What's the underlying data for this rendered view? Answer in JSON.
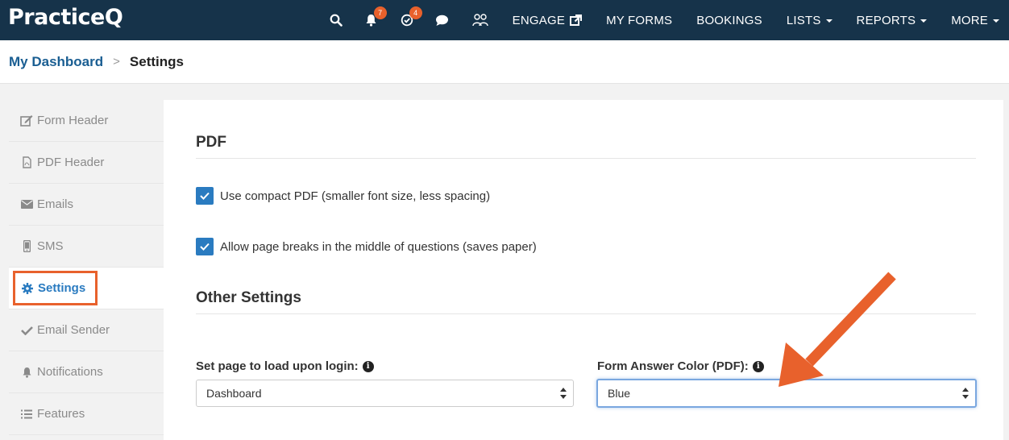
{
  "app": {
    "logo_text": "Practice",
    "logo_q": "Q"
  },
  "nav": {
    "notifications_count": "7",
    "tasks_count": "4",
    "links": [
      {
        "label": "ENGAGE",
        "icon": "external-link-icon"
      },
      {
        "label": "MY FORMS"
      },
      {
        "label": "BOOKINGS"
      },
      {
        "label": "LISTS",
        "dropdown": true
      },
      {
        "label": "REPORTS",
        "dropdown": true
      },
      {
        "label": "MORE",
        "dropdown": true
      }
    ]
  },
  "breadcrumb": {
    "parent": "My Dashboard",
    "separator": ">",
    "current": "Settings"
  },
  "sidebar": {
    "items": [
      {
        "label": "Form Header",
        "icon": "edit-icon"
      },
      {
        "label": "PDF Header",
        "icon": "pdf-file-icon"
      },
      {
        "label": "Emails",
        "icon": "envelope-icon"
      },
      {
        "label": "SMS",
        "icon": "mobile-icon"
      },
      {
        "label": "Settings",
        "icon": "gear-icon",
        "active": true
      },
      {
        "label": "Email Sender",
        "icon": "check-icon"
      },
      {
        "label": "Notifications",
        "icon": "bell-icon"
      },
      {
        "label": "Features",
        "icon": "list-icon"
      }
    ]
  },
  "pdf_section": {
    "title": "PDF",
    "compact_pdf_label": "Use compact PDF (smaller font size, less spacing)",
    "compact_pdf_checked": true,
    "page_breaks_label": "Allow page breaks in the middle of questions (saves paper)",
    "page_breaks_checked": true
  },
  "other_section": {
    "title": "Other Settings",
    "load_page_label": "Set page to load upon login:",
    "load_page_value": "Dashboard",
    "answer_color_label": "Form Answer Color (PDF):",
    "answer_color_value": "Blue"
  },
  "colors": {
    "nav_bg": "#16334a",
    "accent": "#2a7bc0",
    "highlight": "#e8612c",
    "breadcrumb_link": "#1a5e92"
  }
}
